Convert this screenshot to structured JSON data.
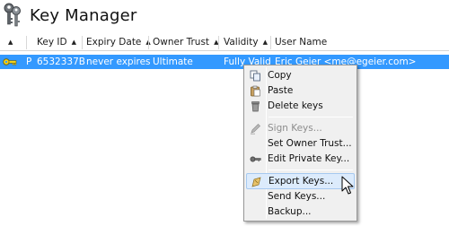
{
  "window": {
    "title": "Key Manager"
  },
  "columns": [
    {
      "label": "",
      "sorted": true
    },
    {
      "label": "Key ID",
      "sorted": true
    },
    {
      "label": "Expiry Date",
      "sorted": true
    },
    {
      "label": "Owner Trust",
      "sorted": true
    },
    {
      "label": "Validity",
      "sorted": true
    },
    {
      "label": "User Name",
      "sorted": false
    }
  ],
  "keys": [
    {
      "type": "P",
      "key_id": "6532337B",
      "expiry": "never expires",
      "owner_trust": "Ultimate",
      "validity": "Fully Valid",
      "user_name": "Eric Geier <me@egeier.com>"
    }
  ],
  "menu": {
    "copy": "Copy",
    "paste": "Paste",
    "delete_keys": "Delete keys",
    "sign_keys": "Sign Keys...",
    "set_owner_trust": "Set Owner Trust...",
    "edit_private_key": "Edit Private Key...",
    "export_keys": "Export Keys...",
    "send_keys": "Send Keys...",
    "backup": "Backup..."
  }
}
